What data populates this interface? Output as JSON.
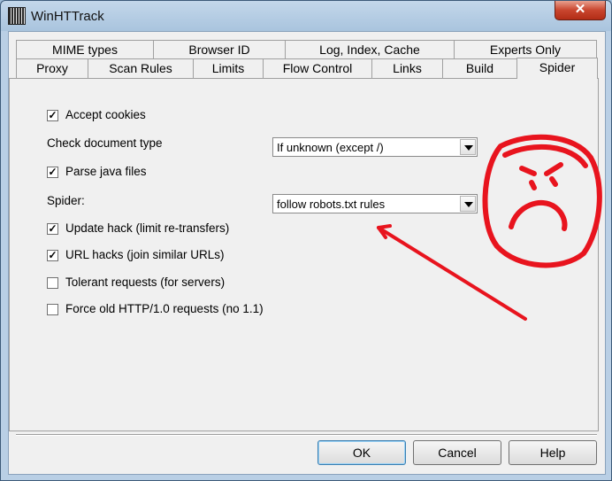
{
  "window": {
    "title": "WinHTTrack",
    "close_glyph": "✕"
  },
  "tabs_back": [
    "MIME types",
    "Browser ID",
    "Log, Index, Cache",
    "Experts Only"
  ],
  "tabs_front": [
    "Proxy",
    "Scan Rules",
    "Limits",
    "Flow Control",
    "Links",
    "Build",
    "Spider"
  ],
  "active_tab": "Spider",
  "options": {
    "accept_cookies": {
      "label": "Accept cookies",
      "checked": true
    },
    "check_doc_type": {
      "label": "Check document type",
      "value": "If unknown (except /)"
    },
    "parse_java": {
      "label": "Parse java files",
      "checked": true
    },
    "spider": {
      "label": "Spider:",
      "value": "follow robots.txt rules"
    },
    "update_hack": {
      "label": "Update hack (limit re-transfers)",
      "checked": true
    },
    "url_hacks": {
      "label": "URL hacks (join similar URLs)",
      "checked": true
    },
    "tolerant": {
      "label": "Tolerant requests (for servers)",
      "checked": false
    },
    "force_old_http": {
      "label": "Force old HTTP/1.0 requests (no 1.1)",
      "checked": false
    }
  },
  "buttons": {
    "ok": "OK",
    "cancel": "Cancel",
    "help": "Help"
  },
  "annotation": {
    "color": "#e8141e",
    "face": "frowning-face-drawing",
    "arrow": "red-arrow-drawing"
  },
  "check_glyph": "✓"
}
